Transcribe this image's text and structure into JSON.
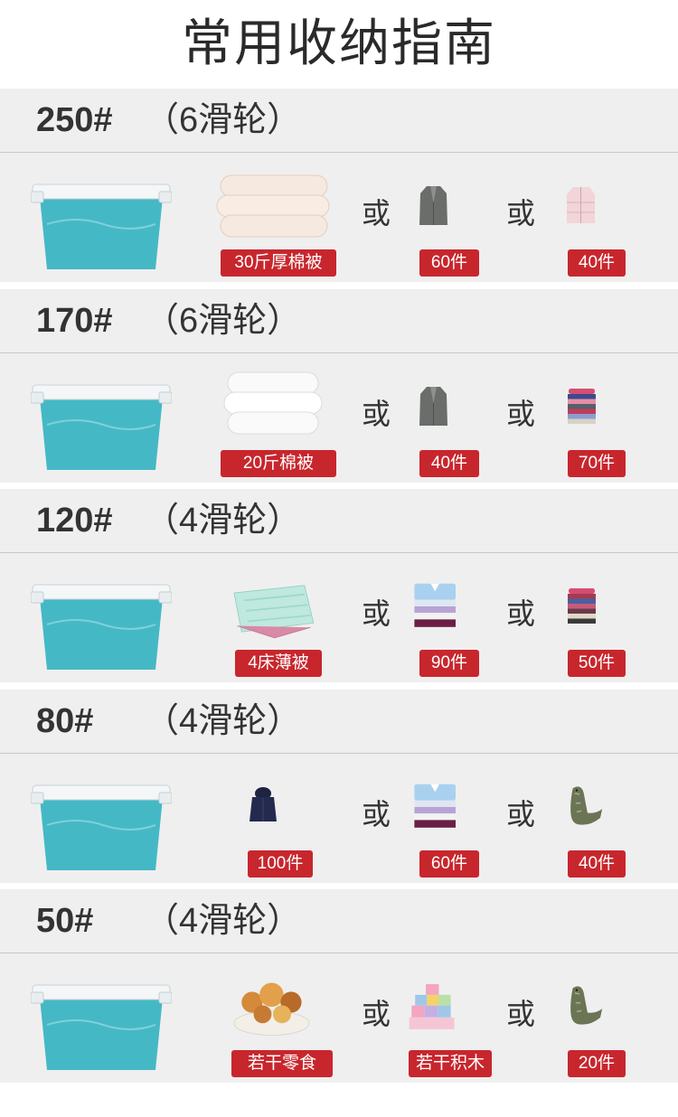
{
  "title": "常用收纳指南",
  "or_label": "或",
  "sections": [
    {
      "size": "250#",
      "wheels": "（6滑轮）",
      "items": [
        {
          "icon": "quilt-icon",
          "label": "30斤厚棉被"
        },
        {
          "icon": "coat-icon",
          "label": "60件"
        },
        {
          "icon": "down-jacket-icon",
          "label": "40件"
        }
      ]
    },
    {
      "size": "170#",
      "wheels": "（6滑轮）",
      "items": [
        {
          "icon": "quilt-icon",
          "label": "20斤棉被"
        },
        {
          "icon": "coat-icon",
          "label": "40件"
        },
        {
          "icon": "sweater-stack-icon",
          "label": "70件"
        }
      ]
    },
    {
      "size": "120#",
      "wheels": "（4滑轮）",
      "items": [
        {
          "icon": "thin-quilt-icon",
          "label": "4床薄被"
        },
        {
          "icon": "shirt-stack-icon",
          "label": "90件"
        },
        {
          "icon": "sweater-stack-icon",
          "label": "50件"
        }
      ]
    },
    {
      "size": "80#",
      "wheels": "（4滑轮）",
      "items": [
        {
          "icon": "kids-jacket-icon",
          "label": "100件"
        },
        {
          "icon": "shirt-stack-icon",
          "label": "60件"
        },
        {
          "icon": "dino-toy-icon",
          "label": "40件"
        }
      ]
    },
    {
      "size": "50#",
      "wheels": "（4滑轮）",
      "items": [
        {
          "icon": "snacks-icon",
          "label": "若干零食"
        },
        {
          "icon": "blocks-icon",
          "label": "若干积木"
        },
        {
          "icon": "dino-toy-icon",
          "label": "20件"
        }
      ]
    }
  ]
}
